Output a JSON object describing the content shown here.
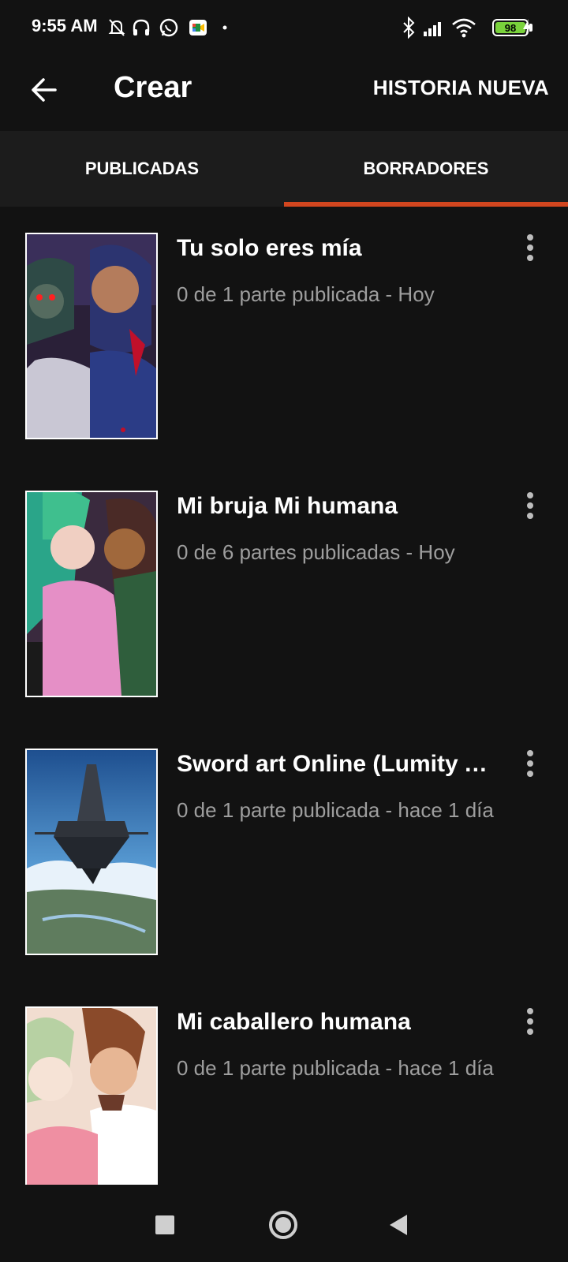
{
  "status_bar": {
    "time": "9:55 AM",
    "battery": "98",
    "icons": [
      "bell-off-icon",
      "headphones-icon",
      "whatsapp-icon",
      "meet-icon",
      "dot-icon",
      "bluetooth-icon",
      "signal-icon",
      "wifi-icon",
      "battery-icon",
      "charging-icon"
    ]
  },
  "app_bar": {
    "title": "Crear",
    "action": "HISTORIA NUEVA"
  },
  "tabs": [
    {
      "label": "PUBLICADAS",
      "active": false
    },
    {
      "label": "BORRADORES",
      "active": true
    }
  ],
  "colors": {
    "accent": "#d2461f",
    "background": "#121212",
    "tab_background": "#1c1c1c",
    "meta_text": "#9e9e9e"
  },
  "stories": [
    {
      "title": "Tu solo eres mía",
      "meta": "0 de 1 parte publicada - Hoy",
      "cover": "dark-art-cover"
    },
    {
      "title": "Mi bruja Mi humana",
      "meta": "0 de 6 partes publicadas - Hoy",
      "cover": "pink-art-cover"
    },
    {
      "title": "Sword art Online (Lumity A…",
      "meta": "0 de 1 parte publicada - hace 1 día",
      "cover": "floating-castle-cover"
    },
    {
      "title": "Mi caballero humana",
      "meta": "0 de 1 parte publicada - hace 1 día",
      "cover": "couple-art-cover"
    }
  ],
  "nav_bar": {
    "buttons": [
      "recents-button",
      "home-button",
      "back-button"
    ]
  }
}
